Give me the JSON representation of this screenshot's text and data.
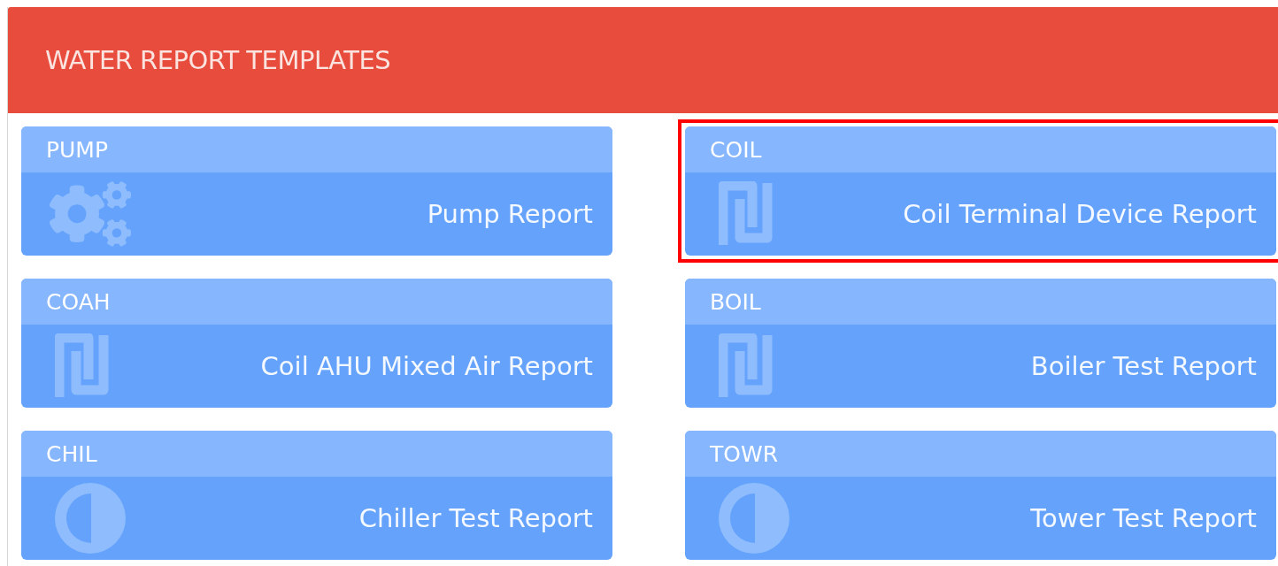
{
  "panel": {
    "title": "WATER REPORT TEMPLATES"
  },
  "templates": [
    {
      "code": "PUMP",
      "name": "Pump Report",
      "kind": "gears",
      "highlighted": false
    },
    {
      "code": "COIL",
      "name": "Coil Terminal Device Report",
      "kind": "coil",
      "highlighted": true
    },
    {
      "code": "COAH",
      "name": "Coil AHU Mixed Air Report",
      "kind": "coil",
      "highlighted": false
    },
    {
      "code": "BOIL",
      "name": "Boiler Test Report",
      "kind": "coil",
      "highlighted": false
    },
    {
      "code": "CHIL",
      "name": "Chiller Test Report",
      "kind": "half-circle",
      "highlighted": false
    },
    {
      "code": "TOWR",
      "name": "Tower Test Report",
      "kind": "half-circle",
      "highlighted": false
    }
  ]
}
